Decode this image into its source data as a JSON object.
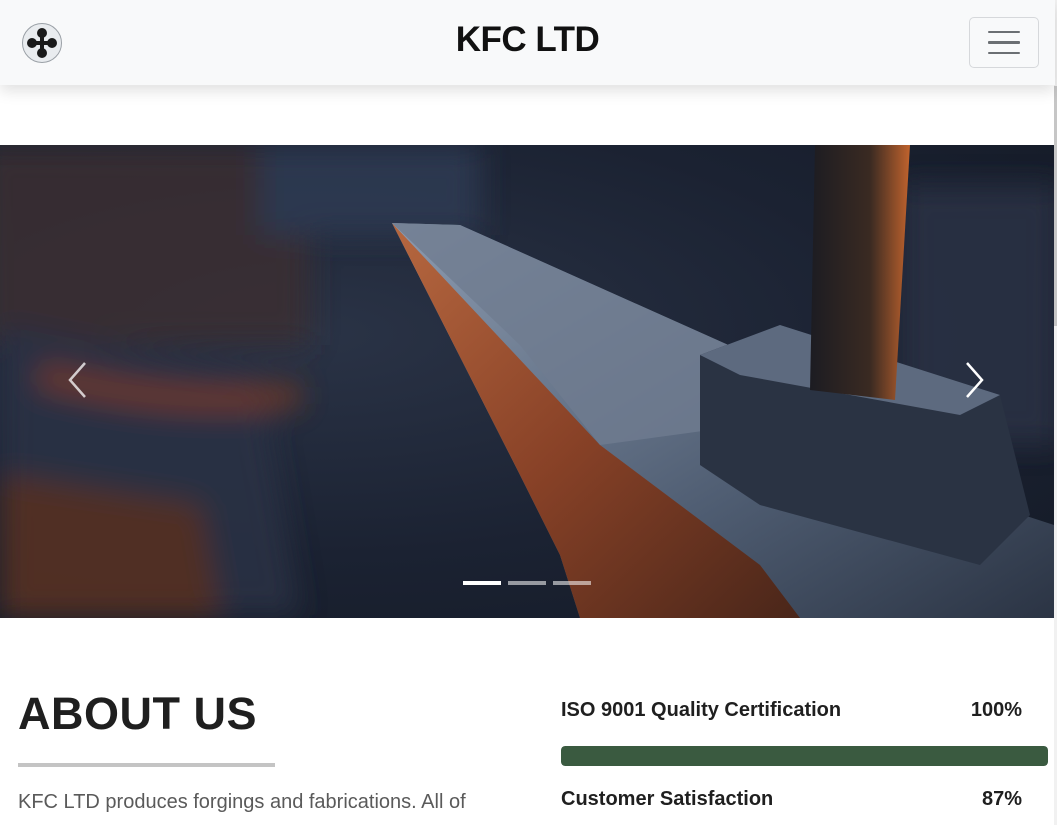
{
  "navbar": {
    "brand": "KFC LTD",
    "logo_icon": "four-ball-cross-logo-icon",
    "menu_icon": "hamburger-menu-icon"
  },
  "carousel": {
    "slides_total": 3,
    "active_slide": 1,
    "prev_icon": "chevron-left-icon",
    "next_icon": "chevron-right-icon"
  },
  "about": {
    "title": "ABOUT US",
    "text": "KFC LTD produces forgings and fabrications. All of"
  },
  "skills": [
    {
      "label": "ISO 9001 Quality Certification",
      "percent_text": "100%",
      "value": 100,
      "color": "#3a5a40"
    },
    {
      "label": "Customer Satisfaction",
      "percent_text": "87%",
      "value": 87,
      "color": "#3a5a40"
    }
  ]
}
